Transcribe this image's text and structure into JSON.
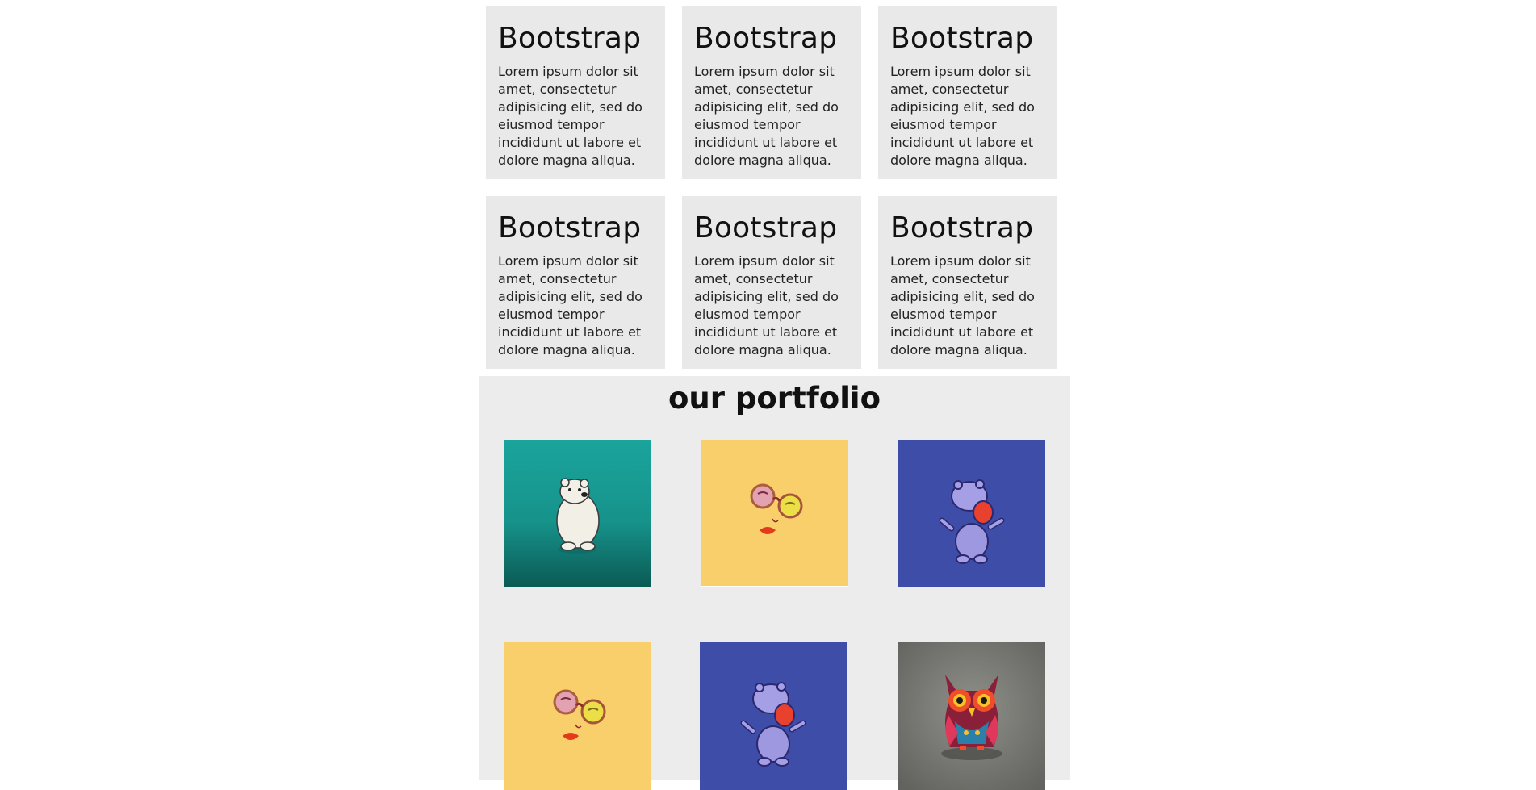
{
  "features": {
    "cards": [
      {
        "title": "Bootstrap",
        "text": "Lorem ipsum dolor sit amet, consectetur adipisicing elit, sed do eiusmod tempor incididunt ut labore et dolore magna aliqua."
      },
      {
        "title": "Bootstrap",
        "text": "Lorem ipsum dolor sit amet, consectetur adipisicing elit, sed do eiusmod tempor incididunt ut labore et dolore magna aliqua."
      },
      {
        "title": "Bootstrap",
        "text": "Lorem ipsum dolor sit amet, consectetur adipisicing elit, sed do eiusmod tempor incididunt ut labore et dolore magna aliqua."
      },
      {
        "title": "Bootstrap",
        "text": "Lorem ipsum dolor sit amet, consectetur adipisicing elit, sed do eiusmod tempor incididunt ut labore et dolore magna aliqua."
      },
      {
        "title": "Bootstrap",
        "text": "Lorem ipsum dolor sit amet, consectetur adipisicing elit, sed do eiusmod tempor incididunt ut labore et dolore magna aliqua."
      },
      {
        "title": "Bootstrap",
        "text": "Lorem ipsum dolor sit amet, consectetur adipisicing elit, sed do eiusmod tempor incididunt ut labore et dolore magna aliqua."
      }
    ]
  },
  "portfolio": {
    "heading": "our portfolio",
    "items": [
      {
        "icon": "polar-bear-illustration",
        "bg": "#1a9e97"
      },
      {
        "icon": "glasses-face-illustration",
        "bg": "#f9cf6b"
      },
      {
        "icon": "hippo-illustration",
        "bg": "#3e4ea8"
      },
      {
        "icon": "glasses-face-illustration",
        "bg": "#f9cf6b"
      },
      {
        "icon": "hippo-illustration",
        "bg": "#3e4ea8"
      },
      {
        "icon": "owl-illustration",
        "bg": "#6f706b"
      }
    ]
  }
}
